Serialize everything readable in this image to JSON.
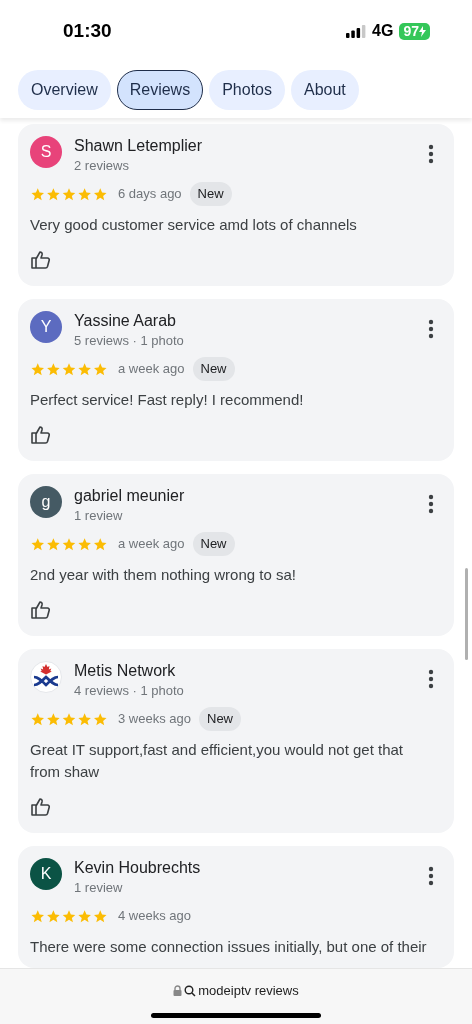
{
  "status_bar": {
    "time": "01:30",
    "network": "4G",
    "battery": "97"
  },
  "tabs": [
    {
      "label": "Overview",
      "selected": false
    },
    {
      "label": "Reviews",
      "selected": true
    },
    {
      "label": "Photos",
      "selected": false
    },
    {
      "label": "About",
      "selected": false
    }
  ],
  "reviews": [
    {
      "avatar": {
        "kind": "letter",
        "letter": "S",
        "color": "#e8437a"
      },
      "name": "Shawn Letemplier",
      "meta": "2 reviews",
      "stars": 5,
      "time": "6 days ago",
      "badge": "New",
      "text": "Very good customer service amd lots of channels"
    },
    {
      "avatar": {
        "kind": "letter",
        "letter": "Y",
        "color": "#5c6bc0"
      },
      "name": "Yassine Aarab",
      "meta": "5 reviews · 1 photo",
      "stars": 5,
      "time": "a week ago",
      "badge": "New",
      "text": "Perfect service! Fast reply! I recommend!"
    },
    {
      "avatar": {
        "kind": "letter",
        "letter": "g",
        "color": "#455a64"
      },
      "name": "gabriel meunier",
      "meta": "1 review",
      "stars": 5,
      "time": "a week ago",
      "badge": "New",
      "text": "2nd year with them nothing wrong to sa!"
    },
    {
      "avatar": {
        "kind": "logo"
      },
      "name": "Metis Network",
      "meta": "4 reviews · 1 photo",
      "stars": 5,
      "time": "3 weeks ago",
      "badge": "New",
      "text": "Great IT support,fast and efficient,you would not get that from shaw"
    },
    {
      "avatar": {
        "kind": "letter",
        "letter": "K",
        "color": "#0b5345"
      },
      "name": "Kevin Houbrechts",
      "meta": "1 review",
      "stars": 5,
      "time": "4 weeks ago",
      "text": "There were some connection issues initially, but one of their"
    }
  ],
  "address_bar": {
    "text": "modeiptv reviews"
  }
}
